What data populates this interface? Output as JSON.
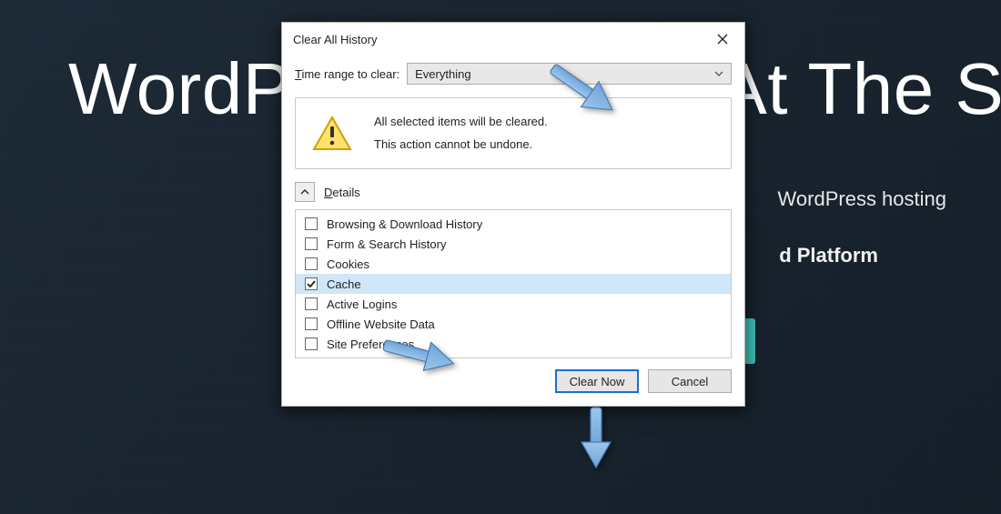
{
  "background": {
    "title": "WordPress Hosting At The Speed Of",
    "subtitle1": "WordPress hosting",
    "subtitle2": "d Platform"
  },
  "dialog": {
    "title": "Clear All History",
    "range_label_pre": "T",
    "range_label_post": "ime range to clear:",
    "range_value": "Everything",
    "warning_line1": "All selected items will be cleared.",
    "warning_line2": "This action cannot be undone.",
    "details_label_pre": "D",
    "details_label_post": "etails",
    "items": [
      {
        "label": "Browsing & Download History",
        "checked": false,
        "selected": false
      },
      {
        "label": "Form & Search History",
        "checked": false,
        "selected": false
      },
      {
        "label": "Cookies",
        "checked": false,
        "selected": false
      },
      {
        "label": "Cache",
        "checked": true,
        "selected": true
      },
      {
        "label": "Active Logins",
        "checked": false,
        "selected": false
      },
      {
        "label": "Offline Website Data",
        "checked": false,
        "selected": false
      },
      {
        "label": "Site Preferences",
        "checked": false,
        "selected": false
      }
    ],
    "primary_btn": "Clear Now",
    "cancel_btn": "Cancel"
  },
  "colors": {
    "arrow_fill": "#7fb3e0",
    "arrow_stroke": "#4a7db0"
  }
}
